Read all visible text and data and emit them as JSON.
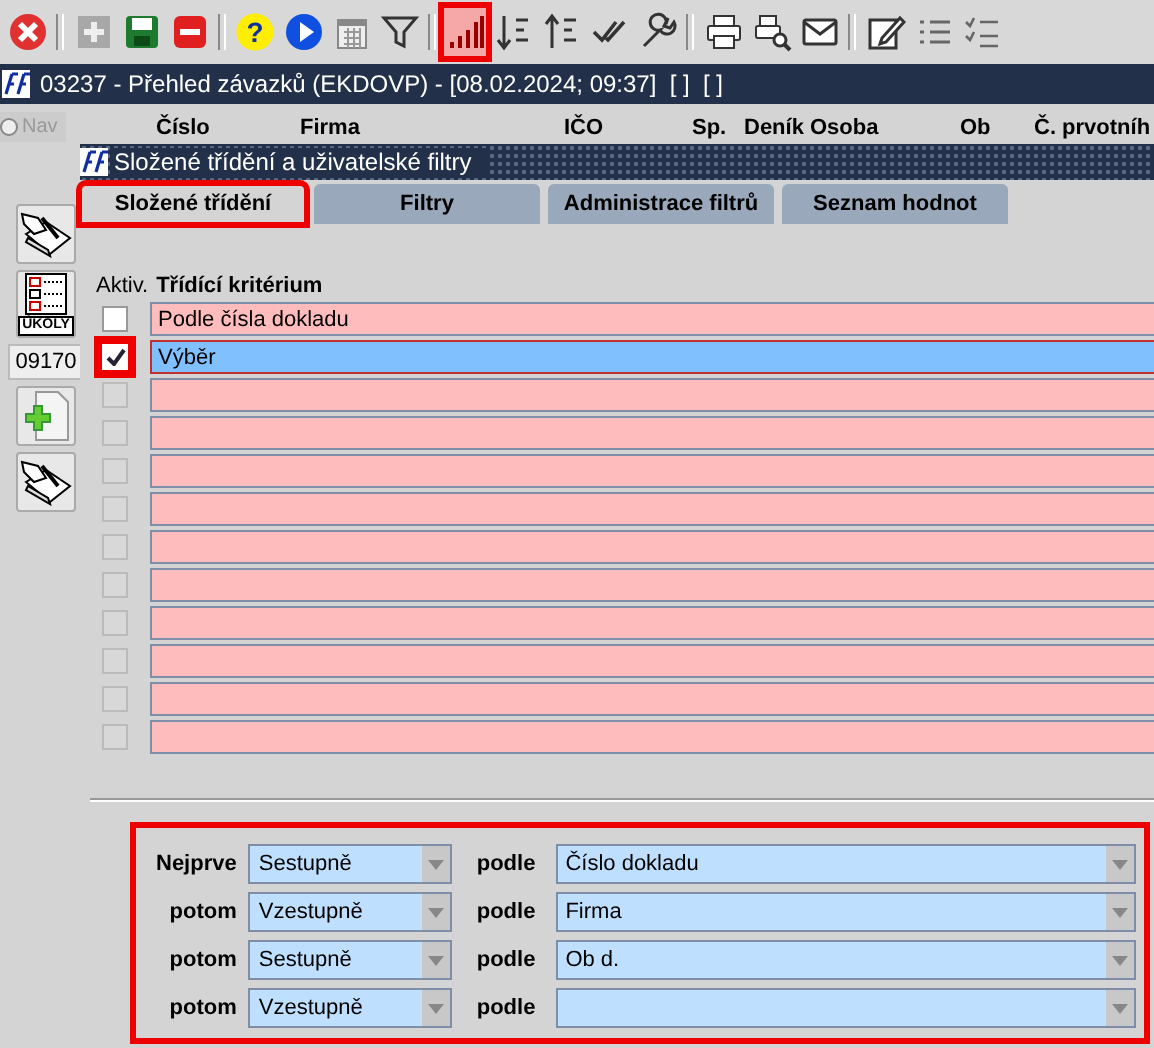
{
  "toolbar": [
    {
      "kind": "close",
      "highlighted": false
    },
    {
      "kind": "separator"
    },
    {
      "kind": "add",
      "highlighted": false
    },
    {
      "kind": "save",
      "highlighted": false
    },
    {
      "kind": "delete",
      "highlighted": false
    },
    {
      "kind": "separator"
    },
    {
      "kind": "help",
      "glyph": "?",
      "highlighted": false
    },
    {
      "kind": "play",
      "highlighted": false
    },
    {
      "kind": "calendar",
      "highlighted": false
    },
    {
      "kind": "filter",
      "highlighted": false
    },
    {
      "kind": "separator"
    },
    {
      "kind": "signal",
      "highlighted": true
    },
    {
      "kind": "sort-down",
      "highlighted": false
    },
    {
      "kind": "sort-up",
      "highlighted": false
    },
    {
      "kind": "check",
      "highlighted": false
    },
    {
      "kind": "wrench",
      "highlighted": false
    },
    {
      "kind": "separator"
    },
    {
      "kind": "print",
      "highlighted": false
    },
    {
      "kind": "preview",
      "highlighted": false
    },
    {
      "kind": "mail",
      "highlighted": false
    },
    {
      "kind": "separator"
    },
    {
      "kind": "edit",
      "highlighted": false
    },
    {
      "kind": "list",
      "highlighted": false
    },
    {
      "kind": "checklist",
      "highlighted": false
    }
  ],
  "window": {
    "title": "03237 - Přehled závazků (EKDOVP) - [08.02.2024; 09:37]  [ ]  [ ]"
  },
  "nav": {
    "label": "Nav",
    "selected": false
  },
  "columns": [
    "Číslo",
    "Firma",
    "IČO",
    "Sp.",
    "Deník",
    "Osoba",
    "Ob",
    "Č. prvotníh"
  ],
  "side_buttons": [
    {
      "kind": "pen"
    },
    {
      "kind": "tasks",
      "label": "ÚKOLY"
    },
    {
      "kind": "code",
      "label": "09170"
    },
    {
      "kind": "new"
    },
    {
      "kind": "pen"
    }
  ],
  "dialog": {
    "title": "Složené třídění a uživatelské filtry",
    "tabs": [
      {
        "label": "Složené třídění",
        "selected": true,
        "highlighted": true
      },
      {
        "label": "Filtry",
        "selected": false,
        "highlighted": false
      },
      {
        "label": "Administrace filtrů",
        "selected": false,
        "highlighted": false
      },
      {
        "label": "Seznam hodnot",
        "selected": false,
        "highlighted": false
      }
    ],
    "grid": {
      "columns": [
        "Aktiv.",
        "Třídící kritérium"
      ],
      "rows": [
        {
          "text": "Podle čísla dokladu",
          "checked": false,
          "disabled": false,
          "selected": false,
          "highlighted": false
        },
        {
          "text": "Výběr",
          "checked": true,
          "disabled": false,
          "selected": true,
          "highlighted": true
        },
        {
          "checked": false,
          "disabled": true,
          "selected": false,
          "highlighted": false
        },
        {
          "checked": false,
          "disabled": true,
          "selected": false,
          "highlighted": false
        },
        {
          "checked": false,
          "disabled": true,
          "selected": false,
          "highlighted": false
        },
        {
          "checked": false,
          "disabled": true,
          "selected": false,
          "highlighted": false
        },
        {
          "checked": false,
          "disabled": true,
          "selected": false,
          "highlighted": false
        },
        {
          "checked": false,
          "disabled": true,
          "selected": false,
          "highlighted": false
        },
        {
          "checked": false,
          "disabled": true,
          "selected": false,
          "highlighted": false
        },
        {
          "checked": false,
          "disabled": true,
          "selected": false,
          "highlighted": false
        },
        {
          "checked": false,
          "disabled": true,
          "selected": false,
          "highlighted": false
        },
        {
          "checked": false,
          "disabled": true,
          "selected": false,
          "highlighted": false
        }
      ]
    },
    "sort_rules_highlighted": true,
    "sort_rules": [
      {
        "label": "Nejprve",
        "order": "Sestupně",
        "by": "podle",
        "field": "Číslo dokladu"
      },
      {
        "label": "potom",
        "order": "Vzestupně",
        "by": "podle",
        "field": "Firma"
      },
      {
        "label": "potom",
        "order": "Sestupně",
        "by": "podle",
        "field": "Ob d."
      },
      {
        "label": "potom",
        "order": "Vzestupně",
        "by": "podle"
      }
    ]
  }
}
